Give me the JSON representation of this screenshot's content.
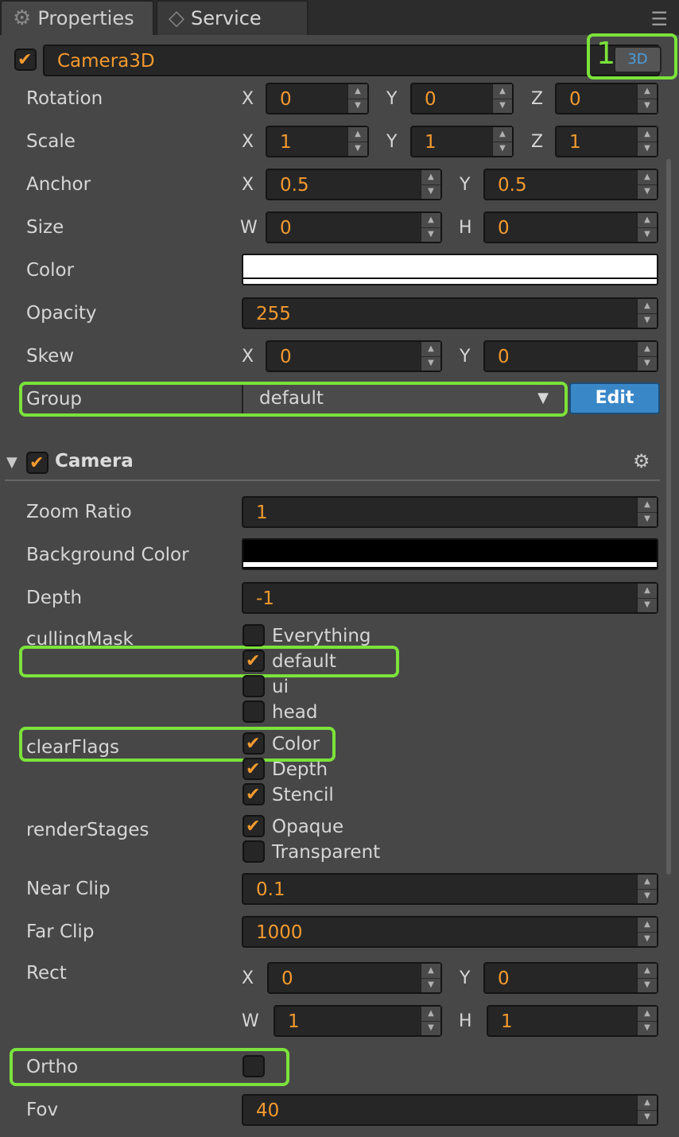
{
  "tabs": {
    "properties": "Properties",
    "service": "Service"
  },
  "node": {
    "name": "Camera3D",
    "mode_button": "3D",
    "annotation_number": "1"
  },
  "props": {
    "rotation": {
      "label": "Rotation",
      "x": "0",
      "y": "0",
      "z": "0"
    },
    "scale": {
      "label": "Scale",
      "x": "1",
      "y": "1",
      "z": "1"
    },
    "anchor": {
      "label": "Anchor",
      "x": "0.5",
      "y": "0.5"
    },
    "size": {
      "label": "Size",
      "w": "0",
      "h": "0"
    },
    "color": {
      "label": "Color",
      "value": "#ffffff"
    },
    "opacity": {
      "label": "Opacity",
      "value": "255"
    },
    "skew": {
      "label": "Skew",
      "x": "0",
      "y": "0"
    },
    "group": {
      "label": "Group",
      "value": "default",
      "edit_button": "Edit"
    }
  },
  "axes": {
    "x": "X",
    "y": "Y",
    "z": "Z",
    "w": "W",
    "h": "H"
  },
  "camera": {
    "title": "Camera",
    "zoom_ratio": {
      "label": "Zoom Ratio",
      "value": "1"
    },
    "background_color": {
      "label": "Background Color",
      "value": "#000000"
    },
    "depth": {
      "label": "Depth",
      "value": "-1"
    },
    "culling_mask": {
      "label": "cullingMask",
      "options": [
        {
          "label": "Everything",
          "checked": false
        },
        {
          "label": "default",
          "checked": true
        },
        {
          "label": "ui",
          "checked": false
        },
        {
          "label": "head",
          "checked": false
        }
      ]
    },
    "clear_flags": {
      "label": "clearFlags",
      "options": [
        {
          "label": "Color",
          "checked": true
        },
        {
          "label": "Depth",
          "checked": true
        },
        {
          "label": "Stencil",
          "checked": true
        }
      ]
    },
    "render_stages": {
      "label": "renderStages",
      "options": [
        {
          "label": "Opaque",
          "checked": true
        },
        {
          "label": "Transparent",
          "checked": false
        }
      ]
    },
    "near_clip": {
      "label": "Near Clip",
      "value": "0.1"
    },
    "far_clip": {
      "label": "Far Clip",
      "value": "1000"
    },
    "rect": {
      "label": "Rect",
      "x": "0",
      "y": "0",
      "w": "1",
      "h": "1"
    },
    "ortho": {
      "label": "Ortho",
      "checked": false
    },
    "fov": {
      "label": "Fov",
      "value": "40"
    }
  },
  "colors": {
    "accent": "#f39a2f",
    "highlight": "#7be23b",
    "edit_button": "#3a87c8"
  }
}
